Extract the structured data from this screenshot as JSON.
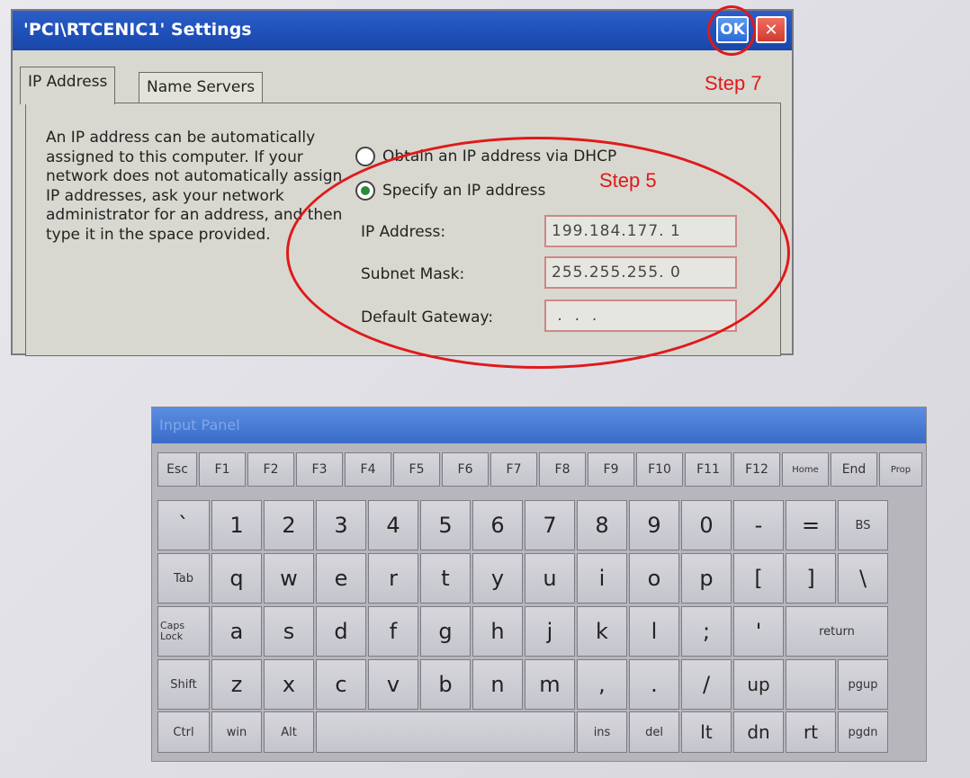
{
  "dialog": {
    "title": "'PCI\\RTCENIC1' Settings",
    "ok_label": "OK",
    "close_label": "✕",
    "tabs": [
      {
        "label": "IP Address",
        "active": true
      },
      {
        "label": "Name Servers",
        "active": false
      }
    ],
    "description": "An IP address can be automatically assigned to this computer. If your network does not automatically assign IP addresses, ask your network administrator for an address, and then type it in the space provided.",
    "radio_dhcp": "Obtain an IP address via DHCP",
    "radio_specify": "Specify an IP address",
    "ip_address_label": "IP Address:",
    "ip_address_value": "199.184.177. 1",
    "subnet_mask_label": "Subnet Mask:",
    "subnet_mask_value": "255.255.255. 0",
    "default_gateway_label": "Default Gateway:",
    "default_gateway_value": " .  .  ."
  },
  "annotations": {
    "step5": "Step 5",
    "step7": "Step 7",
    "color": "#e0191b"
  },
  "input_panel": {
    "title": "Input Panel",
    "rows": [
      [
        "Esc",
        "F1",
        "F2",
        "F3",
        "F4",
        "F5",
        "F6",
        "F7",
        "F8",
        "F9",
        "F10",
        "F11",
        "F12",
        "Home",
        "End",
        "Prop"
      ],
      [
        "`",
        "1",
        "2",
        "3",
        "4",
        "5",
        "6",
        "7",
        "8",
        "9",
        "0",
        "-",
        "=",
        "BS"
      ],
      [
        "Tab",
        "q",
        "w",
        "e",
        "r",
        "t",
        "y",
        "u",
        "i",
        "o",
        "p",
        "[",
        "]",
        "\\"
      ],
      [
        "Caps\nLock",
        "a",
        "s",
        "d",
        "f",
        "g",
        "h",
        "j",
        "k",
        "l",
        ";",
        "'",
        "return"
      ],
      [
        "Shift",
        "z",
        "x",
        "c",
        "v",
        "b",
        "n",
        "m",
        ",",
        ".",
        "/",
        "up",
        "",
        "pgup"
      ],
      [
        "Ctrl",
        "win",
        "Alt",
        "",
        "ins",
        "del",
        "lt",
        "dn",
        "rt",
        "pgdn"
      ]
    ]
  }
}
